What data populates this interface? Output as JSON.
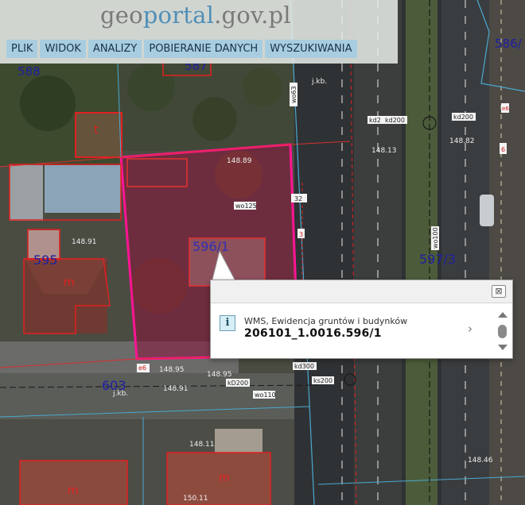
{
  "logo": {
    "prefix": "geo",
    "middle": "portal",
    "suffix": ".gov.pl"
  },
  "menu": [
    "PLIK",
    "WIDOK",
    "ANALIZY",
    "POBIERANIE DANYCH",
    "WYSZUKIWANIA"
  ],
  "parcels": {
    "p588": "588",
    "p596_1": "596/1",
    "p595": "595",
    "p597_3": "597/3",
    "p603": "603",
    "p586": "586/",
    "p587": "587"
  },
  "building_labels": {
    "b1": "t",
    "b2": "m",
    "b3": "m",
    "b4": "m"
  },
  "map_labels": {
    "kd200_a": "kd200",
    "kd200_b": "kd200",
    "kd2": "kd2",
    "kd300": "kd300",
    "ks200": "ks200",
    "kd200_c": "kD200",
    "wo110": "wo110",
    "wo100": "wo100",
    "wo63": "wo63",
    "wo125": "wo125",
    "h1": "148.95",
    "h2": "148.95",
    "h3": "148.91",
    "h4": "148.91",
    "h5": "148.46",
    "h6": "148.11",
    "h7": "148.13",
    "h8": "148.82",
    "h9": "148.89",
    "h10": "150.11",
    "jkb1": "j.kb.",
    "jkb2": "j.kb.",
    "t32": "32",
    "t3": "3",
    "t6": "6",
    "t8": "e6",
    "t9": "e6"
  },
  "popup": {
    "source": "WMS, Ewidencja gruntów i budynków",
    "parcel_id": "206101_1.0016.596/1",
    "close_icon": "close-icon",
    "info_icon": "info-icon",
    "info_glyph": "i",
    "close_glyph": "⊠",
    "next_glyph": "›"
  }
}
